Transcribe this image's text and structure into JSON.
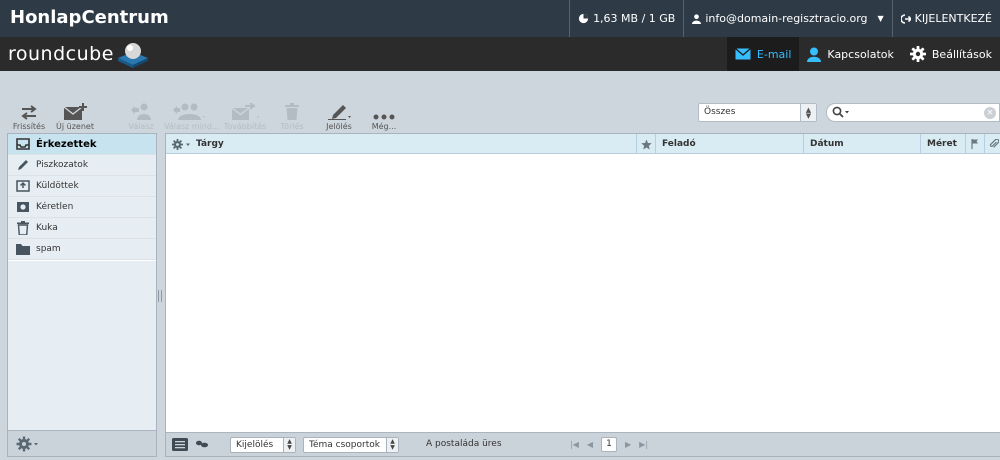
{
  "topbar": {
    "brand": "HonlapCentrum",
    "quota": "1,63 MB / 1 GB",
    "user": "info@domain-regisztracio.org",
    "logout": "KIJELENTKEZÉ"
  },
  "app": {
    "logo_text": "roundcube",
    "nav": [
      {
        "label": "E-mail",
        "icon": "envelope-icon"
      },
      {
        "label": "Kapcsolatok",
        "icon": "person-icon"
      },
      {
        "label": "Beállítások",
        "icon": "gear-icon"
      }
    ]
  },
  "toolbar": {
    "refresh": "Frissítés",
    "compose": "Új üzenet",
    "reply": "Válasz",
    "reply_all": "Válasz mind...",
    "forward": "Továbbítás",
    "delete": "Törlés",
    "mark": "Jelölés",
    "more": "Még..."
  },
  "filter": {
    "selected": "Összes"
  },
  "search": {
    "placeholder": ""
  },
  "folders": {
    "items": [
      {
        "label": "Érkezettek",
        "icon": "inbox-icon",
        "selected": true
      },
      {
        "label": "Piszkozatok",
        "icon": "pencil-icon"
      },
      {
        "label": "Küldöttek",
        "icon": "sent-icon"
      },
      {
        "label": "Kéretlen",
        "icon": "junk-icon"
      },
      {
        "label": "Kuka",
        "icon": "trash-icon"
      },
      {
        "label": "spam",
        "icon": "folder-icon"
      }
    ]
  },
  "messagelist": {
    "columns": {
      "subject": "Tárgy",
      "from": "Feladó",
      "date": "Dátum",
      "size": "Méret"
    },
    "footer": {
      "select": "Kijelölés",
      "threads": "Téma csoportok",
      "status": "A postaláda üres",
      "page": "1"
    }
  },
  "colors": {
    "topbar": "#2e3b47",
    "appbar": "#2b2b2b",
    "accent": "#37beff",
    "selected_folder": "#c7e3f0",
    "list_header": "#d9ecf4"
  }
}
